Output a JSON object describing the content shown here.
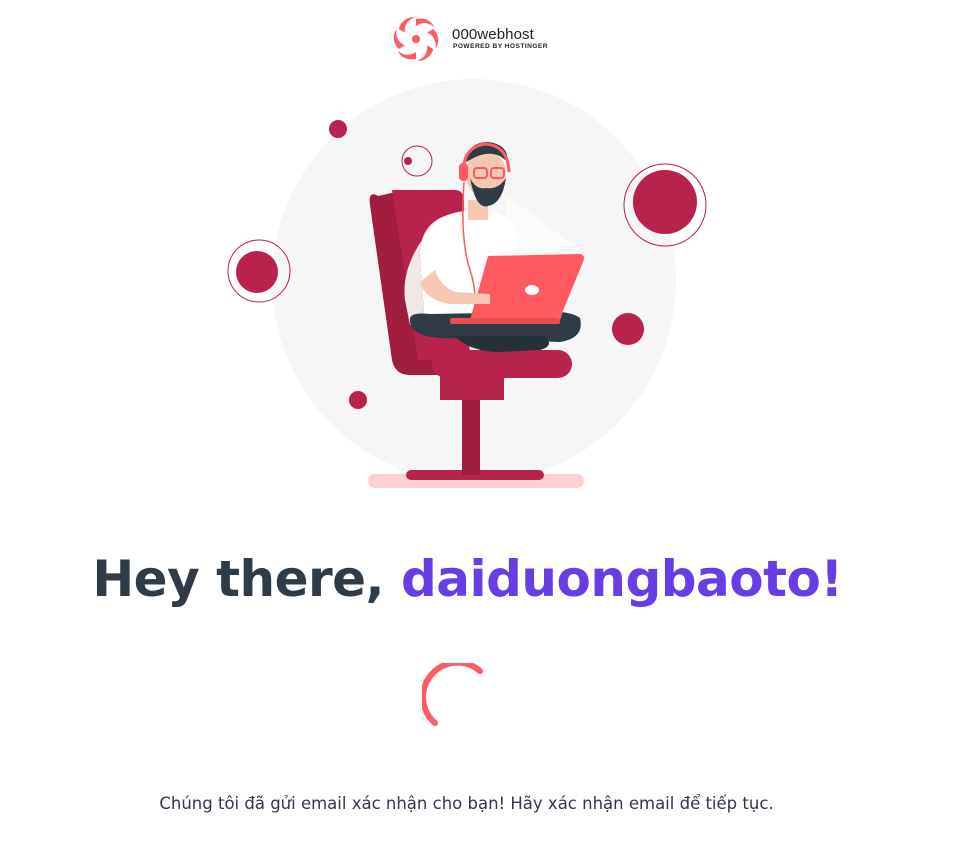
{
  "brand": {
    "name": "000webhost",
    "tagline": "POWERED BY HOSTINGER"
  },
  "greeting": {
    "prefix": "Hey there, ",
    "username": "daiduongbaoto!"
  },
  "message": "Chúng tôi đã gửi email xác nhận cho bạn! Hãy xác nhận email để tiếp tục.",
  "status": "loading",
  "colors": {
    "brand_coral": "#ff5a5f",
    "heading_dark": "#2f3c47",
    "username_purple": "#673de6",
    "chair_red": "#b8234d",
    "body_text": "#36344d"
  },
  "icons": {
    "logo": "000webhost-logo-icon",
    "spinner": "loading-spinner-icon"
  }
}
